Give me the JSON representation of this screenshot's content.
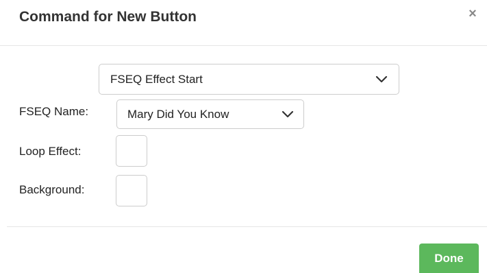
{
  "dialog": {
    "title": "Command for New Button",
    "close_glyph": "×",
    "close_icon": "close-icon"
  },
  "command_select": {
    "value": "FSEQ Effect Start",
    "icon": "chevron-down-icon"
  },
  "fseq_name": {
    "label": "FSEQ Name:",
    "value": "Mary Did You Know",
    "icon": "chevron-down-icon"
  },
  "loop_effect": {
    "label": "Loop Effect:",
    "checked": false
  },
  "background": {
    "label": "Background:",
    "checked": false
  },
  "footer": {
    "done_label": "Done",
    "done_color": "#5cb85c"
  }
}
